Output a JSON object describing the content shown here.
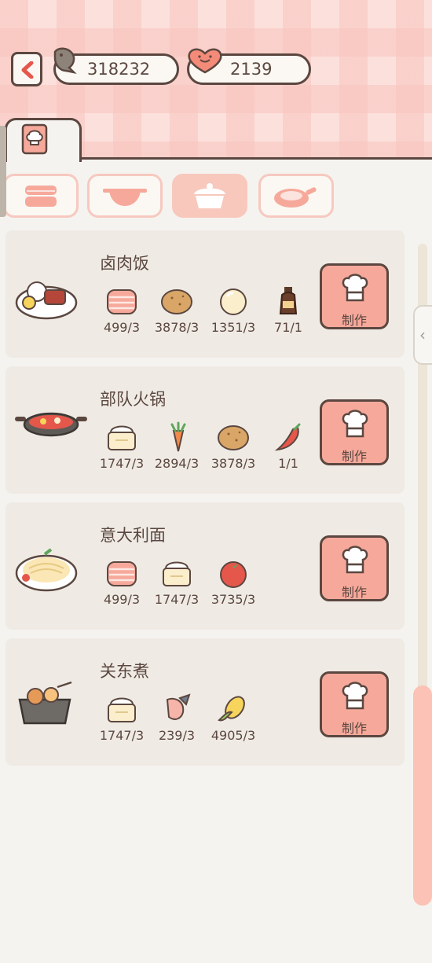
{
  "header": {
    "fish_currency": "318232",
    "heart_currency": "2139"
  },
  "tabs": {
    "book_icon": "cookbook-icon",
    "categories": [
      {
        "icon": "steamer-icon",
        "active": false
      },
      {
        "icon": "pot-icon",
        "active": false
      },
      {
        "icon": "rice-pot-icon",
        "active": true
      },
      {
        "icon": "frying-pan-icon",
        "active": false
      }
    ]
  },
  "recipes": [
    {
      "title": "卤肉饭",
      "dish_icon": "braised-pork-rice-icon",
      "ingredients": [
        {
          "icon": "bacon-icon",
          "count": "499/3"
        },
        {
          "icon": "potato-icon",
          "count": "3878/3"
        },
        {
          "icon": "egg-icon",
          "count": "1351/3"
        },
        {
          "icon": "soy-sauce-icon",
          "count": "71/1"
        }
      ],
      "button": "制作"
    },
    {
      "title": "部队火锅",
      "dish_icon": "army-stew-icon",
      "ingredients": [
        {
          "icon": "rice-bowl-icon",
          "count": "1747/3"
        },
        {
          "icon": "carrot-icon",
          "count": "2894/3"
        },
        {
          "icon": "potato-icon",
          "count": "3878/3"
        },
        {
          "icon": "chili-icon",
          "count": "1/1"
        }
      ],
      "button": "制作"
    },
    {
      "title": "意大利面",
      "dish_icon": "pasta-icon",
      "ingredients": [
        {
          "icon": "bacon-icon",
          "count": "499/3"
        },
        {
          "icon": "rice-bowl-icon",
          "count": "1747/3"
        },
        {
          "icon": "tomato-icon",
          "count": "3735/3"
        }
      ],
      "button": "制作"
    },
    {
      "title": "关东煮",
      "dish_icon": "oden-icon",
      "ingredients": [
        {
          "icon": "rice-bowl-icon",
          "count": "1747/3"
        },
        {
          "icon": "fish-icon",
          "count": "239/3"
        },
        {
          "icon": "corn-icon",
          "count": "4905/3"
        }
      ],
      "button": "制作"
    }
  ]
}
